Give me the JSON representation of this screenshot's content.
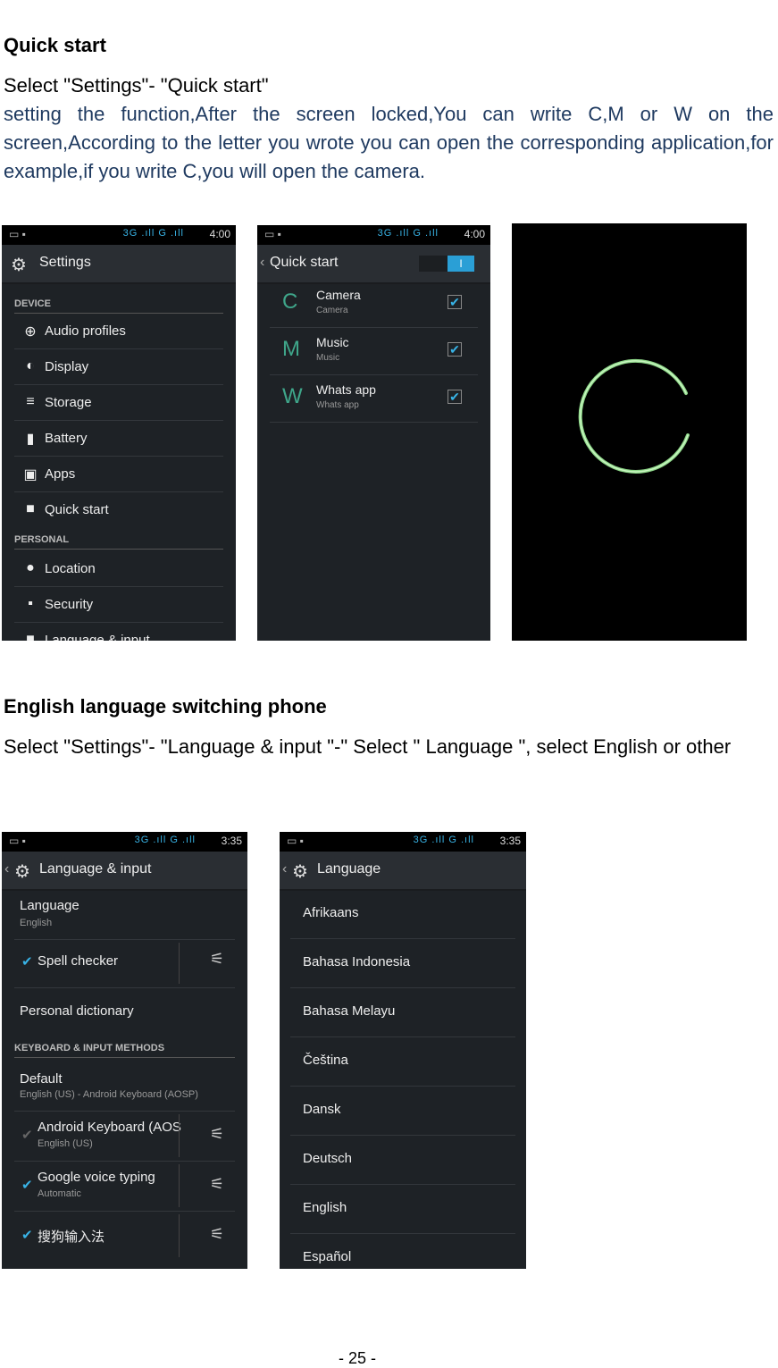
{
  "section1": {
    "heading": "Quick start",
    "instruction": "Select \"Settings\"- \"Quick start\"",
    "description": " setting the function,After the screen locked,You can write C,M or W on the screen,According to the letter you wrote you can open the corresponding application,for example,if you write C,you will open the camera."
  },
  "shot1": {
    "title": "Settings",
    "time": "4:00",
    "network": "3G .ıll G .ıll",
    "section_device": "DEVICE",
    "items": [
      {
        "icon": "⊕",
        "label": "Audio profiles"
      },
      {
        "icon": "◐",
        "label": "Display"
      },
      {
        "icon": "≡",
        "label": "Storage"
      },
      {
        "icon": "▮",
        "label": "Battery"
      },
      {
        "icon": "▣",
        "label": "Apps"
      },
      {
        "icon": "■",
        "label": "Quick start"
      }
    ],
    "section_personal": "PERSONAL",
    "items2": [
      {
        "icon": "●",
        "label": "Location"
      },
      {
        "icon": "▪",
        "label": "Security"
      },
      {
        "icon": "■",
        "label": "Language & input"
      }
    ]
  },
  "shot2": {
    "title": "Quick start",
    "time": "4:00",
    "network": "3G .ıll G .ıll",
    "toggle": "I",
    "apps": [
      {
        "letter": "C",
        "name": "Camera",
        "sub": "Camera"
      },
      {
        "letter": "M",
        "name": "Music",
        "sub": "Music"
      },
      {
        "letter": "W",
        "name": "Whats app",
        "sub": "Whats app"
      }
    ]
  },
  "section2": {
    "heading": "English language switching phone",
    "instruction": "Select \"Settings\"- \"Language & input \"-\" Select \" Language \", select English or other"
  },
  "shot4": {
    "title": "Language & input",
    "time": "3:35",
    "network": "3G .ıll G .ıll",
    "language_label": "Language",
    "language_value": "English",
    "spell_checker": "Spell checker",
    "personal_dictionary": "Personal dictionary",
    "section_keyboard": "KEYBOARD & INPUT METHODS",
    "default_label": "Default",
    "default_value": "English (US) - Android Keyboard (AOSP)",
    "kb1_name": "Android Keyboard (AOS",
    "kb1_sub": "English (US)",
    "kb2_name": "Google voice typing",
    "kb2_sub": "Automatic",
    "kb3_name": "搜狗输入法"
  },
  "shot5": {
    "title": "Language",
    "time": "3:35",
    "network": "3G .ıll G .ıll",
    "languages": [
      "Afrikaans",
      "Bahasa Indonesia",
      "Bahasa Melayu",
      "Čeština",
      "Dansk",
      "Deutsch",
      "English",
      "Español"
    ]
  },
  "footer": {
    "page": "- 25 -"
  }
}
